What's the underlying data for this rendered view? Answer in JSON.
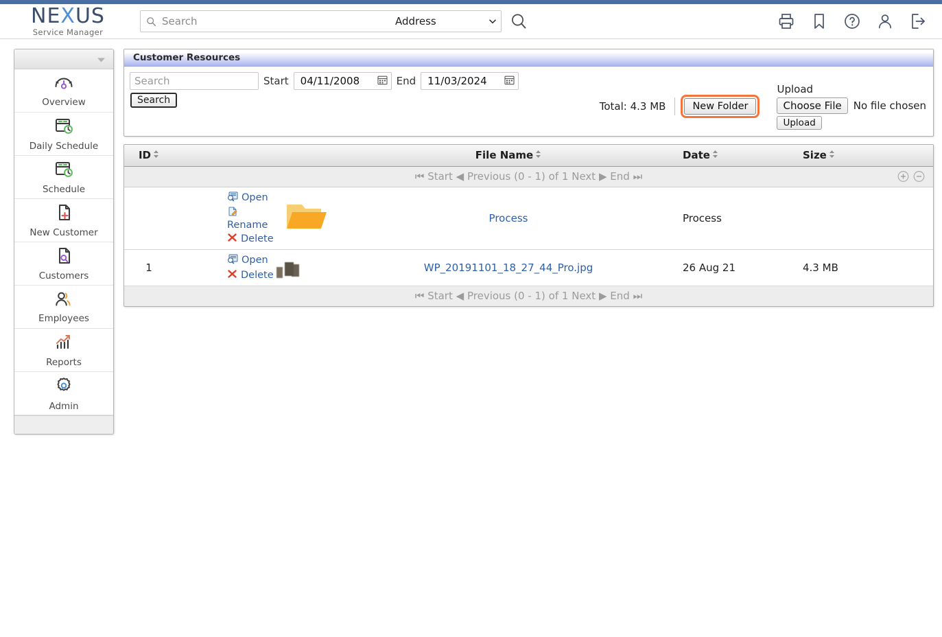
{
  "brand": {
    "name_left": "NE",
    "name_x": "X",
    "name_right": "US",
    "tagline": "Service Manager"
  },
  "header": {
    "search_placeholder": "Search",
    "search_value": "",
    "scope_selected": "Address",
    "scope_options": [
      "Address"
    ],
    "icons": [
      {
        "name": "print-icon",
        "label": "Print"
      },
      {
        "name": "bookmark-icon",
        "label": "Bookmark"
      },
      {
        "name": "help-icon",
        "label": "Help"
      },
      {
        "name": "user-icon",
        "label": "Account"
      },
      {
        "name": "logout-icon",
        "label": "Log out"
      }
    ]
  },
  "sidebar": {
    "items": [
      {
        "label": "Overview",
        "icon": "gauge-icon"
      },
      {
        "label": "Daily Schedule",
        "icon": "calendar-clock-icon"
      },
      {
        "label": "Schedule",
        "icon": "calendar-clock-icon"
      },
      {
        "label": "New Customer",
        "icon": "document-plus-icon"
      },
      {
        "label": "Customers",
        "icon": "document-search-icon"
      },
      {
        "label": "Employees",
        "icon": "people-icon"
      },
      {
        "label": "Reports",
        "icon": "bar-chart-up-icon"
      },
      {
        "label": "Admin",
        "icon": "gear-icon"
      }
    ]
  },
  "panel": {
    "title": "Customer Resources",
    "filter": {
      "search_placeholder": "Search",
      "search_value": "",
      "start_label": "Start",
      "start_value": "04/11/2008",
      "end_label": "End",
      "end_value": "11/03/2024",
      "search_button": "Search"
    },
    "total_label": "Total:",
    "total_value": "4.3 MB",
    "new_folder_button": "New Folder",
    "upload": {
      "title": "Upload",
      "choose_file_button": "Choose File",
      "no_file_text": "No file chosen",
      "upload_button": "Upload"
    }
  },
  "table": {
    "columns": [
      "ID",
      "File Name",
      "Date",
      "Size"
    ],
    "pager": {
      "start": "Start",
      "previous": "Previous",
      "range": "(0 - 1) of 1",
      "next": "Next",
      "end": "End",
      "first_icon": "skip-to-start-icon",
      "prev_icon": "caret-left-icon",
      "next_icon": "caret-right-icon",
      "last_icon": "skip-to-end-icon",
      "expand_icon": "plus-circle-icon",
      "collapse_icon": "minus-circle-icon"
    },
    "rows": [
      {
        "id": "",
        "actions": [
          "Open",
          "Rename",
          "Delete"
        ],
        "thumb": "folder-icon",
        "file_name": "Process",
        "date": "Process",
        "size": ""
      },
      {
        "id": "1",
        "actions": [
          "Open",
          "Delete"
        ],
        "thumb": "photo-thumbnail",
        "file_name": "WP_20191101_18_27_44_Pro.jpg",
        "date": "26 Aug 21",
        "size": "4.3 MB"
      }
    ]
  },
  "colors": {
    "top_accent": "#4a6fa5",
    "brand_dark": "#3b4d6b",
    "brand_x": "#4e8fd6",
    "panel_header_blue": "#aab6f0",
    "focus_ring": "#f4743b",
    "link": "#2d5fa8",
    "folder": "#f5a623"
  }
}
